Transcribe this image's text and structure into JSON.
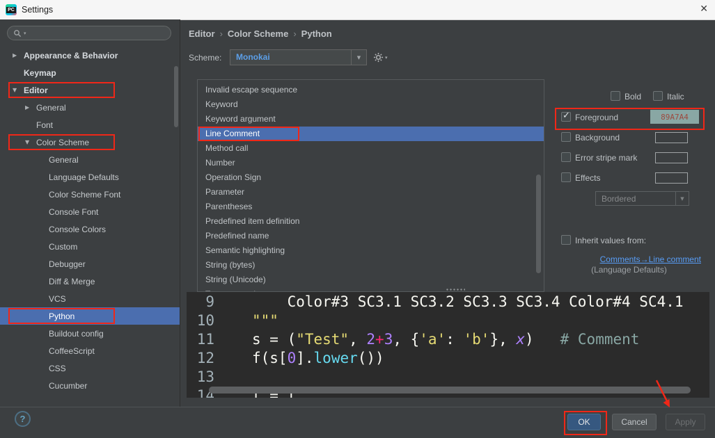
{
  "window": {
    "title": "Settings",
    "close_glyph": "✕",
    "icon_label": "PC"
  },
  "colors": {
    "selection_blue": "#4b6eaf",
    "link_blue": "#589df6",
    "scheme_name_blue": "#5c9fe8",
    "annotation_red": "#f02718",
    "foreground_value": "#89A7A4"
  },
  "sidebar": {
    "tree": [
      {
        "label": "Appearance & Behavior",
        "level": 0,
        "arrow": "collapsed",
        "bold": true
      },
      {
        "label": "Keymap",
        "level": 0,
        "arrow": "none",
        "bold": true
      },
      {
        "label": "Editor",
        "level": 0,
        "arrow": "expanded",
        "bold": true,
        "outlined": true
      },
      {
        "label": "General",
        "level": 1,
        "arrow": "collapsed"
      },
      {
        "label": "Font",
        "level": 1,
        "arrow": "none"
      },
      {
        "label": "Color Scheme",
        "level": 1,
        "arrow": "expanded",
        "outlined": true
      },
      {
        "label": "General",
        "level": 2,
        "arrow": "none"
      },
      {
        "label": "Language Defaults",
        "level": 2,
        "arrow": "none"
      },
      {
        "label": "Color Scheme Font",
        "level": 2,
        "arrow": "none"
      },
      {
        "label": "Console Font",
        "level": 2,
        "arrow": "none"
      },
      {
        "label": "Console Colors",
        "level": 2,
        "arrow": "none"
      },
      {
        "label": "Custom",
        "level": 2,
        "arrow": "none"
      },
      {
        "label": "Debugger",
        "level": 2,
        "arrow": "none"
      },
      {
        "label": "Diff & Merge",
        "level": 2,
        "arrow": "none"
      },
      {
        "label": "VCS",
        "level": 2,
        "arrow": "none"
      },
      {
        "label": "Python",
        "level": 2,
        "arrow": "none",
        "selected": true,
        "outlined": true
      },
      {
        "label": "Buildout config",
        "level": 2,
        "arrow": "none"
      },
      {
        "label": "CoffeeScript",
        "level": 2,
        "arrow": "none"
      },
      {
        "label": "CSS",
        "level": 2,
        "arrow": "none"
      },
      {
        "label": "Cucumber",
        "level": 2,
        "arrow": "none"
      }
    ]
  },
  "breadcrumb": {
    "items": [
      "Editor",
      "Color Scheme",
      "Python"
    ],
    "separator": "›"
  },
  "scheme": {
    "label": "Scheme:",
    "value": "Monokai"
  },
  "element_list": {
    "items": [
      {
        "label": "Invalid escape sequence"
      },
      {
        "label": "Keyword"
      },
      {
        "label": "Keyword argument"
      },
      {
        "label": "Line Comment",
        "selected": true,
        "outlined": true
      },
      {
        "label": "Method call"
      },
      {
        "label": "Number"
      },
      {
        "label": "Operation Sign"
      },
      {
        "label": "Parameter"
      },
      {
        "label": "Parentheses"
      },
      {
        "label": "Predefined item definition"
      },
      {
        "label": "Predefined name"
      },
      {
        "label": "Semantic highlighting"
      },
      {
        "label": "String (bytes)"
      },
      {
        "label": "String (Unicode)"
      },
      {
        "label": "Type annotations"
      }
    ]
  },
  "attributes": {
    "bold_label": "Bold",
    "italic_label": "Italic",
    "foreground": {
      "label": "Foreground",
      "checked": true,
      "value": "89A7A4",
      "swatch_color": "#89a7a4"
    },
    "background": {
      "label": "Background",
      "checked": false
    },
    "error_stripe": {
      "label": "Error stripe mark",
      "checked": false
    },
    "effects": {
      "label": "Effects",
      "checked": false
    },
    "effects_style": "Bordered",
    "inherit_label": "Inherit values from:",
    "inherit_link": "Comments→Line comment",
    "inherit_note": "(Language Defaults)"
  },
  "preview": {
    "palette": {
      "plain": "#f8f8f2",
      "string": "#e6db74",
      "number": "#ae81ff",
      "operator": "#f92672",
      "comment": "#89a7a4",
      "func": "#66d9ef"
    },
    "lines": [
      {
        "num": "9",
        "tokens": [
          {
            "t": "    Color#3 SC3.1 SC3.2 SC3.3 SC3.4 Color#4 SC4.1",
            "c": "plain"
          }
        ]
      },
      {
        "num": "10",
        "tokens": [
          {
            "t": "\"\"\"",
            "c": "string"
          }
        ]
      },
      {
        "num": "11",
        "tokens": [
          {
            "t": "s = (",
            "c": "plain"
          },
          {
            "t": "\"Test\"",
            "c": "string"
          },
          {
            "t": ", ",
            "c": "plain"
          },
          {
            "t": "2",
            "c": "number"
          },
          {
            "t": "+",
            "c": "operator"
          },
          {
            "t": "3",
            "c": "number"
          },
          {
            "t": ", {",
            "c": "plain"
          },
          {
            "t": "'a'",
            "c": "string"
          },
          {
            "t": ": ",
            "c": "plain"
          },
          {
            "t": "'b'",
            "c": "string"
          },
          {
            "t": "}, ",
            "c": "plain"
          },
          {
            "t": "x",
            "c": "number",
            "i": true
          },
          {
            "t": ")   ",
            "c": "plain"
          },
          {
            "t": "# Comment",
            "c": "comment"
          }
        ]
      },
      {
        "num": "12",
        "tokens": [
          {
            "t": "f(s[",
            "c": "plain"
          },
          {
            "t": "0",
            "c": "number"
          },
          {
            "t": "].",
            "c": "plain"
          },
          {
            "t": "lower",
            "c": "func"
          },
          {
            "t": "())",
            "c": "plain"
          }
        ]
      },
      {
        "num": "13",
        "tokens": []
      },
      {
        "num": "14",
        "tokens": [
          {
            "t": "l = [",
            "c": "plain"
          }
        ]
      }
    ]
  },
  "footer": {
    "help_glyph": "?",
    "ok": "OK",
    "cancel": "Cancel",
    "apply": "Apply"
  }
}
